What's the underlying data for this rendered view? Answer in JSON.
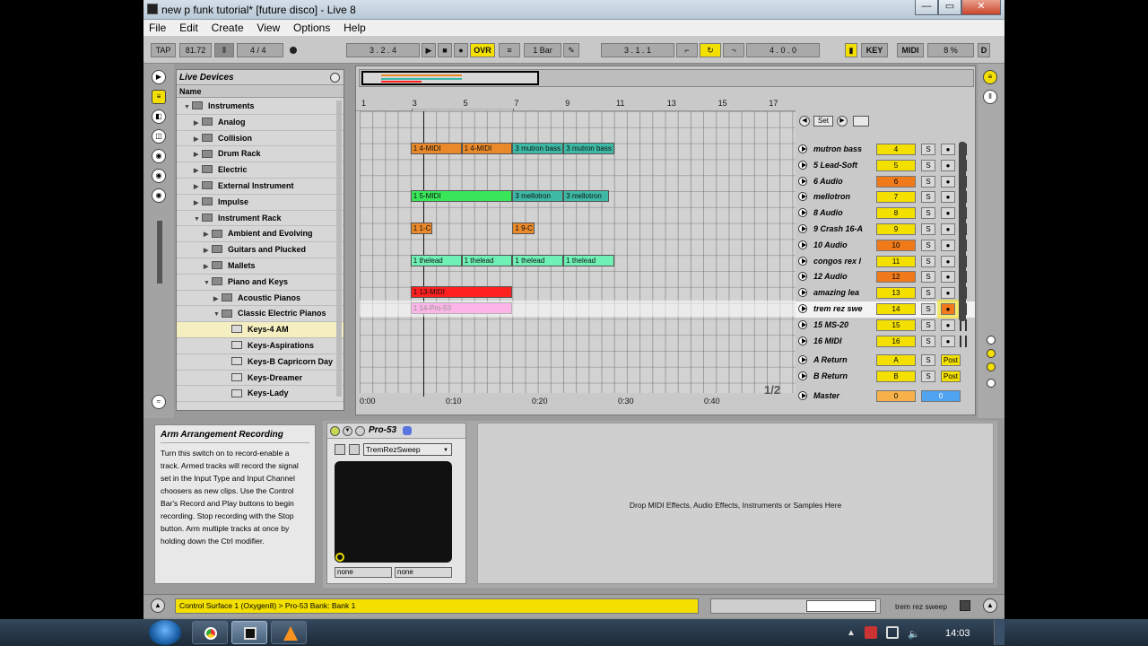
{
  "window": {
    "title": "new p funk tutorial*  [future disco] - Live 8",
    "min_label": "—",
    "max_label": "▭",
    "close_label": "✕"
  },
  "menu": [
    "File",
    "Edit",
    "Create",
    "View",
    "Options",
    "Help"
  ],
  "control_bar": {
    "tap": "TAP",
    "tempo": "81.72",
    "meter": "4 / 4",
    "position": "3 .  2 .  4",
    "ovr": "OVR",
    "quantize": "1 Bar",
    "loop_start": "3 .  1 .  1",
    "loop_length": "4 .  0 .  0",
    "key": "KEY",
    "midi": "MIDI",
    "cpu": "8 %",
    "d": "D"
  },
  "browser": {
    "title": "Live Devices",
    "column": "Name",
    "items": [
      {
        "label": "Instruments",
        "level": 0,
        "open": true,
        "kind": "folder"
      },
      {
        "label": "Analog",
        "level": 1,
        "open": false,
        "kind": "folder"
      },
      {
        "label": "Collision",
        "level": 1,
        "open": false,
        "kind": "folder"
      },
      {
        "label": "Drum Rack",
        "level": 1,
        "open": false,
        "kind": "folder"
      },
      {
        "label": "Electric",
        "level": 1,
        "open": false,
        "kind": "folder"
      },
      {
        "label": "External Instrument",
        "level": 1,
        "open": false,
        "kind": "folder"
      },
      {
        "label": "Impulse",
        "level": 1,
        "open": false,
        "kind": "folder"
      },
      {
        "label": "Instrument Rack",
        "level": 1,
        "open": true,
        "kind": "folder"
      },
      {
        "label": "Ambient and Evolving",
        "level": 2,
        "open": false,
        "kind": "folder"
      },
      {
        "label": "Guitars and Plucked",
        "level": 2,
        "open": false,
        "kind": "folder"
      },
      {
        "label": "Mallets",
        "level": 2,
        "open": false,
        "kind": "folder"
      },
      {
        "label": "Piano and Keys",
        "level": 2,
        "open": true,
        "kind": "folder"
      },
      {
        "label": "Acoustic Pianos",
        "level": 3,
        "open": false,
        "kind": "folder"
      },
      {
        "label": "Classic Electric Pianos",
        "level": 3,
        "open": true,
        "kind": "folder"
      },
      {
        "label": "Keys-4 AM",
        "level": 4,
        "kind": "preset",
        "selected": true
      },
      {
        "label": "Keys-Aspirations",
        "level": 4,
        "kind": "preset"
      },
      {
        "label": "Keys-B Capricorn Day",
        "level": 4,
        "kind": "preset"
      },
      {
        "label": "Keys-Dreamer",
        "level": 4,
        "kind": "preset"
      },
      {
        "label": "Keys-Lady",
        "level": 4,
        "kind": "preset"
      }
    ]
  },
  "arrangement": {
    "set_label": "Set",
    "ruler": [
      "1",
      "3",
      "5",
      "7",
      "9",
      "11",
      "13",
      "15",
      "17"
    ],
    "time_axis": [
      "0:00",
      "0:10",
      "0:20",
      "0:30",
      "0:40"
    ],
    "page": "1/2",
    "clips": [
      {
        "row": 0,
        "start": 4,
        "len": 4,
        "label": "1 4-MIDI",
        "color": "#e9892a"
      },
      {
        "row": 0,
        "start": 8,
        "len": 4,
        "label": "1 4-MIDI",
        "color": "#e9892a"
      },
      {
        "row": 0,
        "start": 12,
        "len": 4,
        "label": "3 mutron bass",
        "color": "#3db9a5"
      },
      {
        "row": 0,
        "start": 16,
        "len": 4,
        "label": "3 mutron bass",
        "color": "#3db9a5"
      },
      {
        "row": 3,
        "start": 4,
        "len": 8,
        "label": "1 5-MIDI",
        "color": "#39e65a"
      },
      {
        "row": 3,
        "start": 12,
        "len": 4,
        "label": "3 mellotron",
        "color": "#3db9a5"
      },
      {
        "row": 3,
        "start": 16,
        "len": 3.6,
        "label": "3 mellotron",
        "color": "#3db9a5"
      },
      {
        "row": 5,
        "start": 4,
        "len": 1.7,
        "label": "1 1-C",
        "color": "#e9892a"
      },
      {
        "row": 5,
        "start": 12,
        "len": 1.7,
        "label": "1 9-C",
        "color": "#e9892a"
      },
      {
        "row": 7,
        "start": 4,
        "len": 4,
        "label": "1 thelead",
        "color": "#6ff0b5"
      },
      {
        "row": 7,
        "start": 8,
        "len": 4,
        "label": "1 thelead",
        "color": "#6ff0b5"
      },
      {
        "row": 7,
        "start": 12,
        "len": 4,
        "label": "1 thelead",
        "color": "#6ff0b5"
      },
      {
        "row": 7,
        "start": 16,
        "len": 4,
        "label": "1 thelead",
        "color": "#6ff0b5"
      },
      {
        "row": 9,
        "start": 4,
        "len": 8,
        "label": "1 13-MIDI",
        "color": "#ff2020"
      },
      {
        "row": 10,
        "start": 4,
        "len": 8,
        "label": "1 14-Pro-53",
        "color": "#f55cc8"
      }
    ],
    "tracks": [
      {
        "name": "mutron bass",
        "num": "4",
        "color": "#f4e000"
      },
      {
        "name": "5 Lead-Soft",
        "num": "5",
        "color": "#f4e000"
      },
      {
        "name": "6 Audio",
        "num": "6",
        "color": "#f07a1a"
      },
      {
        "name": "mellotron",
        "num": "7",
        "color": "#f4e000"
      },
      {
        "name": "8 Audio",
        "num": "8",
        "color": "#f4e000"
      },
      {
        "name": "9 Crash 16-A",
        "num": "9",
        "color": "#f4e000"
      },
      {
        "name": "10 Audio",
        "num": "10",
        "color": "#f07a1a"
      },
      {
        "name": "congos rex l",
        "num": "11",
        "color": "#f4e000"
      },
      {
        "name": "12 Audio",
        "num": "12",
        "color": "#f07a1a"
      },
      {
        "name": "amazing lea",
        "num": "13",
        "color": "#f4e000"
      },
      {
        "name": "trem rez swe",
        "num": "14",
        "color": "#f4e000",
        "armed": true
      },
      {
        "name": "15 MS-20",
        "num": "15",
        "color": "#f4e000"
      },
      {
        "name": "16 MIDI",
        "num": "16",
        "color": "#f4e000"
      }
    ],
    "returns": [
      {
        "name": "A Return",
        "num": "A",
        "post": "Post"
      },
      {
        "name": "B Return",
        "num": "B",
        "post": "Post"
      }
    ],
    "master": {
      "name": "Master",
      "left": "0",
      "right": "0"
    },
    "solo": "S"
  },
  "info": {
    "title": "Arm Arrangement Recording",
    "text": "Turn this switch on to record-enable a track. Armed tracks will record the signal set in the Input Type and Input Channel choosers as new clips. Use the Control Bar's Record and Play buttons to begin recording. Stop recording with the Stop button. Arm multiple tracks at once by holding down the Ctrl modifier."
  },
  "device": {
    "name": "Pro-53",
    "preset": "TremRezSweep",
    "x_label": "none",
    "y_label": "none",
    "drop_hint": "Drop MIDI Effects, Audio Effects, Instruments or Samples Here"
  },
  "status": {
    "text": "Control Surface 1 (Oxygen8) > Pro-53 Bank: Bank 1",
    "track": "trem rez sweep"
  },
  "taskbar": {
    "clock": "14:03"
  }
}
